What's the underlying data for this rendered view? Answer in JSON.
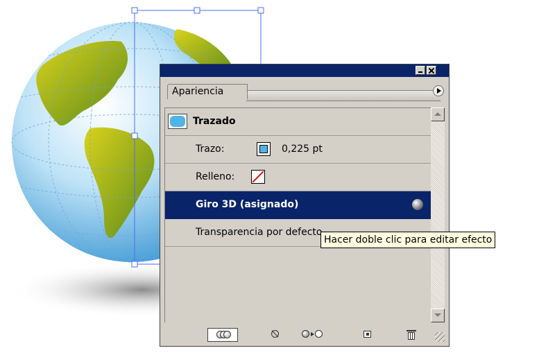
{
  "panel": {
    "tab_label": "Apariencia",
    "object_label": "Trazado",
    "rows": {
      "stroke": {
        "label": "Trazo:",
        "value": "0,225 pt"
      },
      "fill": {
        "label": "Relleno:"
      },
      "effect": {
        "label": "Giro 3D (asignado)"
      },
      "transparency": {
        "label": "Transparencia por defecto"
      }
    },
    "colors": {
      "titlebar": "#0a246a",
      "selection": "#0a246a",
      "panel_bg": "#d4d0c8",
      "stroke_swatch": "#4fb4e6",
      "none_slash": "#e01010"
    },
    "icons": {
      "menu": "menu-arrow-icon",
      "effect": "3d-effect-icon",
      "footer": [
        "new-art-basic-appearance-icon",
        "clear-appearance-icon",
        "reduce-to-basic-appearance-icon",
        "duplicate-item-icon",
        "delete-item-icon"
      ]
    }
  },
  "tooltip": {
    "text": "Hacer doble clic para editar efecto"
  },
  "artwork": {
    "subject": "globe-icon",
    "selection_color": "#4a6cf7"
  }
}
